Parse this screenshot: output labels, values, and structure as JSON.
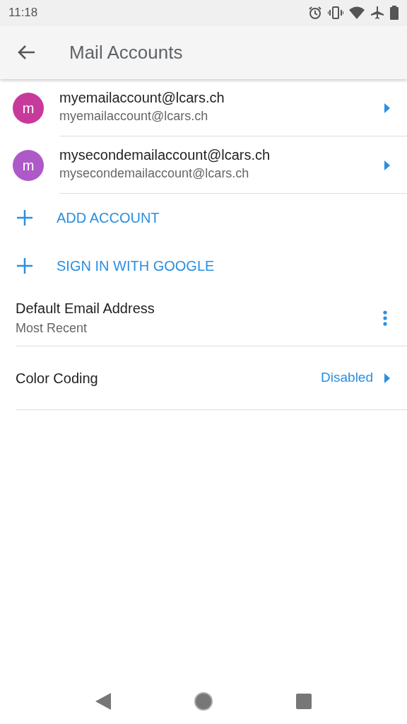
{
  "status_bar": {
    "time": "11:18"
  },
  "app_bar": {
    "title": "Mail Accounts"
  },
  "accounts": [
    {
      "initial": "m",
      "name": "myemailaccount@lcars.ch",
      "email": "myemailaccount@lcars.ch",
      "color": "#c73a9c"
    },
    {
      "initial": "m",
      "name": "mysecondemailaccount@lcars.ch",
      "email": "mysecondemailaccount@lcars.ch",
      "color": "#ad5ac8"
    }
  ],
  "actions": [
    {
      "label": "ADD ACCOUNT"
    },
    {
      "label": "SIGN IN WITH GOOGLE"
    }
  ],
  "settings": [
    {
      "kind": "menu",
      "title": "Default Email Address",
      "subtitle": "Most Recent"
    },
    {
      "kind": "value",
      "title": "Color Coding",
      "value": "Disabled"
    }
  ]
}
